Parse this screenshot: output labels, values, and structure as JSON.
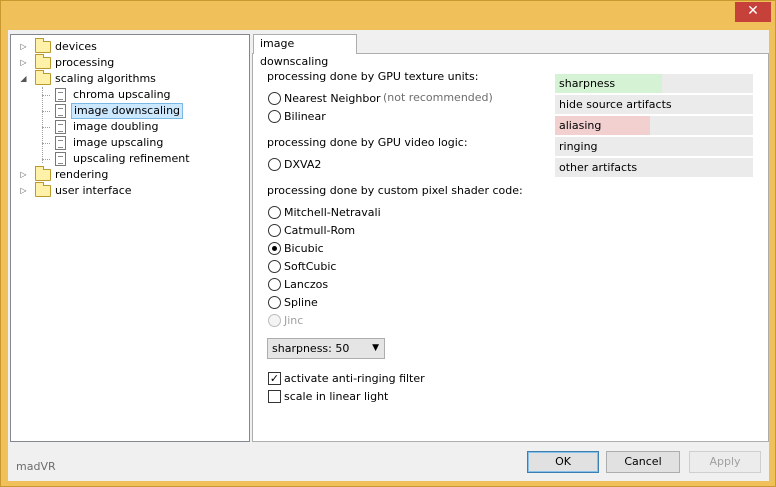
{
  "window": {
    "close_glyph": "✕"
  },
  "tree": {
    "items": [
      {
        "label": "devices",
        "icon": "folder-icon",
        "expander": "▷"
      },
      {
        "label": "processing",
        "icon": "folder-icon",
        "expander": "▷"
      },
      {
        "label": "scaling algorithms",
        "icon": "folder-icon",
        "expander": "◢"
      },
      {
        "label": "chroma upscaling",
        "icon": "document-icon"
      },
      {
        "label": "image downscaling",
        "icon": "document-icon",
        "selected": true
      },
      {
        "label": "image doubling",
        "icon": "document-icon"
      },
      {
        "label": "image upscaling",
        "icon": "document-icon"
      },
      {
        "label": "upscaling refinement",
        "icon": "document-icon"
      },
      {
        "label": "rendering",
        "icon": "folder-icon",
        "expander": "▷"
      },
      {
        "label": "user interface",
        "icon": "folder-icon",
        "expander": "▷"
      }
    ]
  },
  "tab": {
    "label": "image downscaling"
  },
  "panel": {
    "gpu_texture_heading": "processing done by GPU texture units:",
    "nearest_neighbor": "Nearest Neighbor",
    "not_recommended": "(not recommended)",
    "bilinear": "Bilinear",
    "gpu_video_heading": "processing done by GPU video logic:",
    "dxva2": "DXVA2",
    "shader_heading": "processing done by custom pixel shader code:",
    "mitchell": "Mitchell-Netravali",
    "catmull": "Catmull-Rom",
    "bicubic": "Bicubic",
    "softcubic": "SoftCubic",
    "lanczos": "Lanczos",
    "spline": "Spline",
    "jinc": "Jinc",
    "selected_algorithm": "Bicubic",
    "sharpness_value": "sharpness: 50",
    "anti_ringing_label": "activate anti-ringing filter",
    "anti_ringing_checked": true,
    "linear_light_label": "scale in linear light",
    "linear_light_checked": false
  },
  "quality": [
    {
      "label": "sharpness",
      "level": 0.54,
      "color": "#d5f2d5"
    },
    {
      "label": "hide source artifacts",
      "level": 0,
      "color": "#ebebeb"
    },
    {
      "label": "aliasing",
      "level": 0.48,
      "color": "#f2d0d0"
    },
    {
      "label": "ringing",
      "level": 0,
      "color": "#ebebeb"
    },
    {
      "label": "other artifacts",
      "level": 0,
      "color": "#ebebeb"
    }
  ],
  "footer": {
    "app_name": "madVR",
    "ok": "OK",
    "cancel": "Cancel",
    "apply": "Apply"
  }
}
